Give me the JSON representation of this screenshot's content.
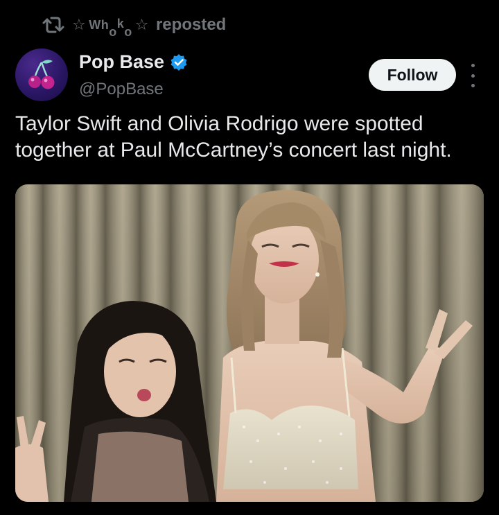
{
  "repost": {
    "icon": "repost-icon",
    "reposter_parts": [
      "Wh",
      "o",
      "k",
      "o"
    ],
    "label": "reposted"
  },
  "author": {
    "name": "Pop Base",
    "handle": "@PopBase",
    "verified": true,
    "avatar_icon": "cherry-icon"
  },
  "follow_label": "Follow",
  "tweet_text": "Taylor Swift and Olivia Rodrigo were spotted together at Paul McCartney’s concert last night.",
  "colors": {
    "background": "#000000",
    "primary_text": "#e7e9ea",
    "secondary_text": "#71767b",
    "verified": "#1d9bf0",
    "follow_bg": "#eff3f4",
    "follow_text": "#0f1419"
  }
}
